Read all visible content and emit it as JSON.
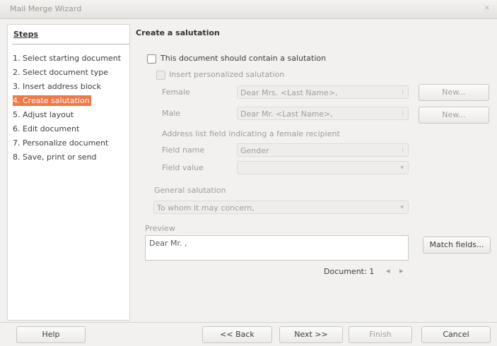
{
  "window": {
    "title": "Mail Merge Wizard",
    "close": "×"
  },
  "steps": {
    "heading": "Steps",
    "items": [
      {
        "label": "1. Select starting document"
      },
      {
        "label": "2. Select document type"
      },
      {
        "label": "3. Insert address block"
      },
      {
        "label": "4. Create salutation",
        "active": true
      },
      {
        "label": "5. Adjust layout"
      },
      {
        "label": "6. Edit document"
      },
      {
        "label": "7. Personalize document"
      },
      {
        "label": "8. Save, print or send"
      }
    ]
  },
  "main": {
    "heading": "Create a salutation",
    "contain_salutation": "This document should contain a salutation",
    "insert_personalized": "Insert personalized salutation",
    "female_label": "Female",
    "female_value": "Dear Mrs. <Last Name>,",
    "male_label": "Male",
    "male_value": "Dear Mr. <Last Name>,",
    "new_label": "New...",
    "address_field_caption": "Address list field indicating a female recipient",
    "field_name_label": "Field name",
    "field_name_value": "Gender",
    "field_value_label": "Field value",
    "field_value_value": "",
    "general_salutation_label": "General salutation",
    "general_salutation_value": "To whom it may concern,",
    "preview_label": "Preview",
    "preview_text": "Dear Mr. ,",
    "match_fields": "Match fields...",
    "document_label": "Document: 1",
    "prev_arrow": "◂",
    "next_arrow": "▸"
  },
  "footer": {
    "help": "Help",
    "back": "<< Back",
    "next": "Next >>",
    "finish": "Finish",
    "cancel": "Cancel"
  }
}
